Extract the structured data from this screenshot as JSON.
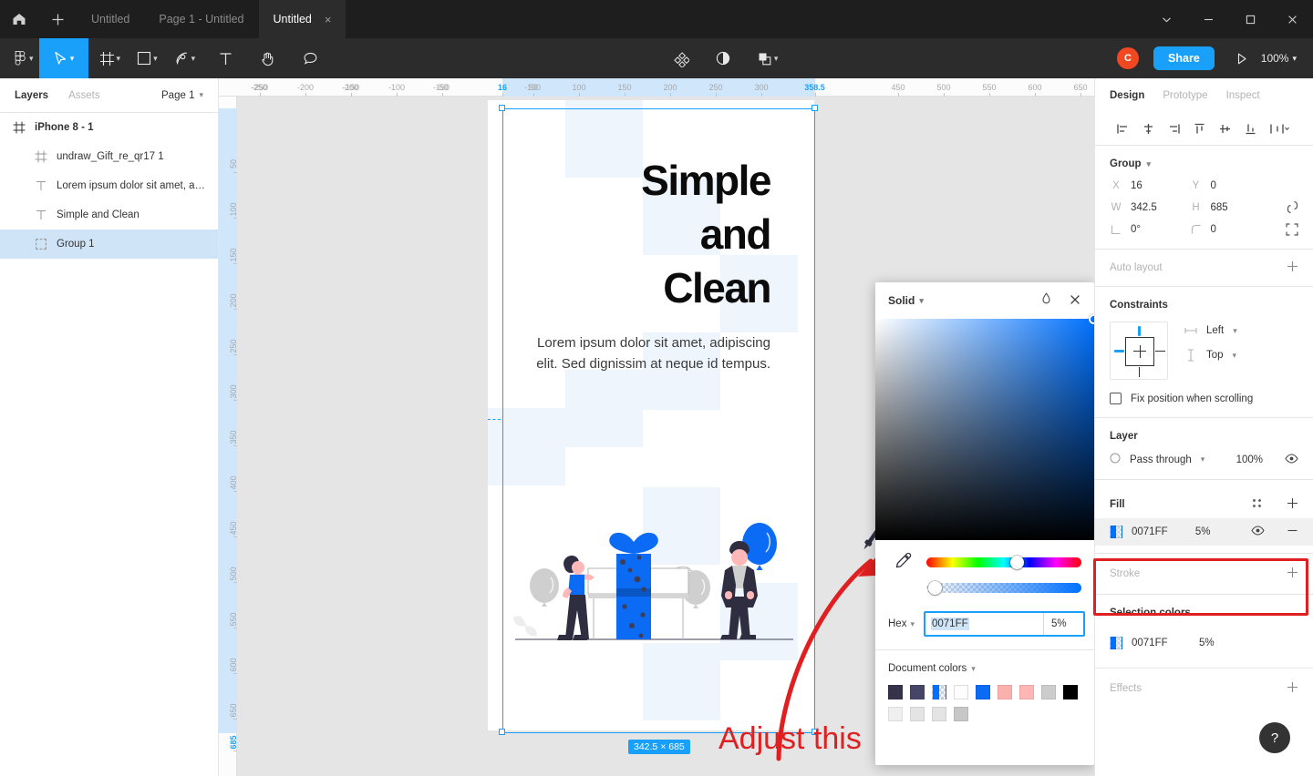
{
  "titlebar": {
    "home_icon": "home-icon",
    "new_icon": "plus-icon",
    "tabs": [
      {
        "label": "Untitled",
        "active": false,
        "closable": false
      },
      {
        "label": "Page 1 - Untitled",
        "active": false,
        "closable": false
      },
      {
        "label": "Untitled",
        "active": true,
        "closable": true
      }
    ],
    "close_glyph": "×",
    "window": {
      "chevron": "⌄",
      "minimize": "—",
      "maximize": "□",
      "close": "✕"
    }
  },
  "toolbar": {
    "menu_label": "figma-menu-icon",
    "tools": [
      {
        "name": "move-tool",
        "caret": true,
        "active": true
      },
      {
        "name": "frame-tool",
        "caret": true,
        "active": false
      },
      {
        "name": "shape-tool",
        "caret": true,
        "active": false
      },
      {
        "name": "pen-tool",
        "caret": true,
        "active": false
      },
      {
        "name": "text-tool",
        "caret": false,
        "active": false
      },
      {
        "name": "hand-tool",
        "caret": false,
        "active": false
      },
      {
        "name": "comment-tool",
        "caret": false,
        "active": false
      }
    ],
    "components_icon": "components-icon",
    "mask_icon": "mask-icon",
    "boolean_icon": "boolean-union-icon",
    "avatar_initial": "C",
    "avatar_color": "#f24822",
    "share_label": "Share",
    "share_color": "#18a0fb",
    "present_icon": "play-icon",
    "zoom_label": "100%"
  },
  "left_panel": {
    "tabs": [
      {
        "label": "Layers",
        "active": true
      },
      {
        "label": "Assets",
        "active": false
      }
    ],
    "page_selector": "Page 1",
    "layers": [
      {
        "name": "iPhone 8 - 1",
        "icon": "frame-icon",
        "depth": 0,
        "selected": false
      },
      {
        "name": "undraw_Gift_re_qr17 1",
        "icon": "frame-icon",
        "depth": 1,
        "selected": false
      },
      {
        "name": "Lorem ipsum dolor sit amet, a…",
        "icon": "text-icon",
        "depth": 1,
        "selected": false
      },
      {
        "name": "Simple and Clean",
        "icon": "text-icon",
        "depth": 1,
        "selected": false
      },
      {
        "name": "Group 1",
        "icon": "group-icon",
        "depth": 1,
        "selected": true
      }
    ]
  },
  "canvas": {
    "artboard_label": "iPhone 8 - 1",
    "ruler_h_ticks": [
      "-250",
      "-200",
      "-150",
      "-100",
      "-50",
      "16",
      "50",
      "100",
      "150",
      "200",
      "250",
      "300",
      "358.5",
      "450",
      "500",
      "550",
      "600",
      "650"
    ],
    "ruler_h_highlight": [
      "16",
      "358.5"
    ],
    "ruler_v_ticks": [
      "50",
      "100",
      "150",
      "200",
      "250",
      "300",
      "350",
      "400",
      "450",
      "500",
      "550",
      "600",
      "650",
      "685"
    ],
    "ruler_v_highlight": [
      "685"
    ],
    "selection_size_badge": "342.5 × 685",
    "artboard": {
      "heading": "Simple and Clean",
      "heading_lines": [
        "Simple",
        "and",
        "Clean"
      ],
      "body": "Lorem ipsum dolor sit amet, adipiscing elit. Sed dignissim at neque id tempus.",
      "illustration_name": "undraw-gift-illustration",
      "pattern_color": "#eef5fd",
      "accent_color": "#0b6ef5"
    }
  },
  "annotation": {
    "text": "Adjust this",
    "color": "#e02020"
  },
  "color_picker": {
    "mode": "Solid",
    "eyedropper_icon": "eyedropper-icon",
    "close_icon": "close-icon",
    "format_label": "Hex",
    "hex_value": "0071FF",
    "alpha_value": "5%",
    "document_colors_label": "Document colors",
    "swatches_row1": [
      "#353349",
      "#464566",
      "alpha-blue",
      "#fdfdfd",
      "#0c6bf5",
      "#fcb0ae",
      "#fdb6b4",
      "#cccccc",
      "#000000"
    ],
    "swatches_row2": [
      "#efefef",
      "#e4e4e4",
      "#e3e3e3",
      "#c7c7c7"
    ]
  },
  "right_panel": {
    "tabs": [
      {
        "label": "Design",
        "active": true
      },
      {
        "label": "Prototype",
        "active": false
      },
      {
        "label": "Inspect",
        "active": false
      }
    ],
    "align_buttons": [
      "align-left-icon",
      "align-horizontal-center-icon",
      "align-right-icon",
      "align-top-icon",
      "align-vertical-center-icon",
      "align-bottom-icon",
      "distribute-icon"
    ],
    "object_type": "Group",
    "properties": {
      "x_label": "X",
      "x_value": "16",
      "y_label": "Y",
      "y_value": "0",
      "w_label": "W",
      "w_value": "342.5",
      "h_label": "H",
      "h_value": "685",
      "rotation_label": "rotation",
      "rotation_value": "0°",
      "corner_label": "corner-radius",
      "corner_value": "0",
      "constrain_proportions_icon": "link-icon",
      "independent_corners_icon": "independent-corners-icon"
    },
    "auto_layout_label": "Auto layout",
    "constraints": {
      "title": "Constraints",
      "horizontal": "Left",
      "vertical": "Top",
      "fix_position_label": "Fix position when scrolling",
      "fix_position_checked": false
    },
    "layer": {
      "title": "Layer",
      "blend_mode": "Pass through",
      "opacity": "100%",
      "visible_icon": "eye-icon"
    },
    "fill": {
      "title": "Fill",
      "style_icon": "style-picker-icon",
      "add_icon": "plus-icon",
      "items": [
        {
          "hex": "0071FF",
          "opacity": "5%",
          "visible_icon": "eye-icon",
          "remove_icon": "minus-icon"
        }
      ],
      "highlight_color": "#e02020"
    },
    "stroke": {
      "title": "Stroke",
      "add_icon": "plus-icon"
    },
    "selection_colors": {
      "title": "Selection colors",
      "items": [
        {
          "hex": "0071FF",
          "opacity": "5%"
        }
      ]
    },
    "effects": {
      "title": "Effects",
      "add_icon": "plus-icon"
    },
    "help_label": "?"
  }
}
